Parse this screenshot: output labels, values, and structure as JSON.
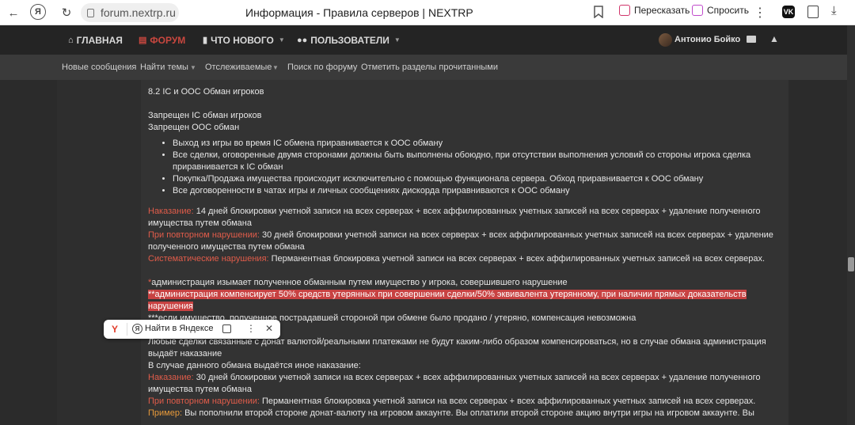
{
  "browser": {
    "url": "forum.nextrp.ru",
    "tab_title": "Информация - Правила серверов | NEXTRP",
    "share_label": "Пересказать",
    "ask_label": "Спросить",
    "vk_label": "VK"
  },
  "nav": {
    "items": [
      {
        "label": "ГЛАВНАЯ",
        "icon": "home-icon"
      },
      {
        "label": "ФОРУМ",
        "icon": "forum-icon"
      },
      {
        "label": "ЧТО НОВОГО",
        "icon": "speech-bubble-icon"
      },
      {
        "label": "ПОЛЬЗОВАТЕЛИ",
        "icon": "users-icon"
      }
    ],
    "user_name": "Антонио Бойко"
  },
  "subnav": {
    "items": [
      "Новые сообщения",
      "Найти темы",
      "Отслеживаемые",
      "Поиск по форуму",
      "Отметить разделы прочитанными"
    ]
  },
  "post": {
    "heading": "8.2 IC и OOC Обман игроков",
    "line1": "Запрещен IC обман игроков",
    "line2": "Запрещен OOC обман",
    "bullets": [
      "Выход из игры во время IC обмена приравнивается к OOC обману",
      "Все сделки, оговоренные двумя сторонами должны быть выполнены обоюдно, при отсутствии выполнения условий со стороны игрока сделка приравнивается к IC обман",
      "Покупка/Продажа имущества происходит исключительно с помощью функционала сервера. Обход приравнивается к OOC обману",
      "Все договоренности в чатах игры и личных сообщениях дискорда приравниваются к OOC обману"
    ],
    "p1_label": "Наказание:",
    "p1_text": " 14 дней блокировки учетной записи на всех серверах + всех аффилированных учетных записей на всех серверах + удаление полученного имущества путем обмана",
    "p2_label": "При повторном нарушении:",
    "p2_text": " 30 дней блокировки учетной записи на всех серверах + всех аффилированных учетных записей на всех серверах + удаление полученного имущества путем обмана",
    "p3_label": "Систематические нарушения:",
    "p3_text": " Перманентная блокировка учетной записи на всех серверах + всех аффилированных учетных записей на всех серверах.",
    "note1_star": "*",
    "note1_text": "администрация изымает полученное обманным путем имущество у игрока, совершившего нарушение",
    "note2_text": "**администрация компенсирует 50% средств утерянных при совершении сделки/50% эквивалента утерянному, при наличии прямых доказательств нарушения",
    "note3_text": "***если имущество, полученное пострадавшей стороной при обмене было продано / утеряно, компенсация невозможна",
    "donate1": "Любые сделки связанные с донат валютой/реальными платежами не будут каким-либо образом компенсироваться, но в случае обмана администрация выдаёт наказание",
    "donate2": "В случае данного обмана выдаётся иное наказание:",
    "d1_label": "Наказание:",
    "d1_text": " 30 дней блокировки учетной записи на всех серверах + всех аффилированных учетных записей на всех серверах + удаление полученного имущества путем обмана",
    "d2_label": "При повторном нарушении:",
    "d2_text": " Перманентная блокировка учетной записи на всех серверах + всех аффилированных учетных записей на всех серверах.",
    "ex_label": "Пример:",
    "ex_text": " Вы пополнили второй стороне донат-валюту на игровом аккаунте. Вы оплатили второй стороне акцию внутри игры на игровом аккаунте. Вы"
  },
  "popup": {
    "search_label": "Найти в Яндексе"
  }
}
